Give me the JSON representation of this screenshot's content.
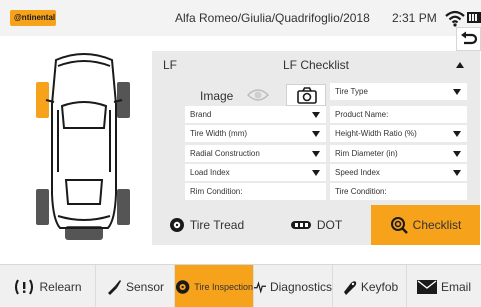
{
  "header": {
    "logo_text": "@ntinental",
    "vehicle_path": "Alfa Romeo/Giulia/Quadrifoglio/2018",
    "time": "2:31 PM",
    "wifi_icon": "wifi-icon",
    "battery_icon": "battery-icon",
    "back_icon": "back-arrow-icon"
  },
  "car": {
    "selected_tire": "LF",
    "highlight_color": "#f7a21b"
  },
  "panel": {
    "position_label": "LF",
    "title": "LF Checklist",
    "image_label": "Image",
    "fields": [
      {
        "label": "Tire Type",
        "dropdown": true
      },
      {
        "label": "Brand",
        "dropdown": true
      },
      {
        "label": "Product Name:",
        "dropdown": false
      },
      {
        "label": "Tire Width (mm)",
        "dropdown": true
      },
      {
        "label": "Height-Width Ratio (%)",
        "dropdown": true
      },
      {
        "label": "Radial Construction",
        "dropdown": true
      },
      {
        "label": "Rim Diameter (in)",
        "dropdown": true
      },
      {
        "label": "Load Index",
        "dropdown": true
      },
      {
        "label": "Speed Index",
        "dropdown": true
      },
      {
        "label": "Rim Condition:",
        "dropdown": false
      },
      {
        "label": "Tire Condition:",
        "dropdown": false
      }
    ]
  },
  "tabs": [
    {
      "label": "Tire Tread",
      "icon": "tire-icon",
      "active": false
    },
    {
      "label": "DOT",
      "icon": "dot-icon",
      "active": false
    },
    {
      "label": "Checklist",
      "icon": "checklist-icon",
      "active": true
    }
  ],
  "nav": [
    {
      "label": "Relearn",
      "icon": "tpms-warning-icon",
      "active": false
    },
    {
      "label": "Sensor",
      "icon": "sensor-icon",
      "active": false
    },
    {
      "label": "Tire Inspection",
      "icon": "tire-icon",
      "active": true
    },
    {
      "label": "Diagnostics",
      "icon": "pulse-icon",
      "active": false
    },
    {
      "label": "Keyfob",
      "icon": "keyfob-icon",
      "active": false
    },
    {
      "label": "Email",
      "icon": "email-icon",
      "active": false
    }
  ],
  "colors": {
    "accent": "#f7a21b",
    "panel_bg": "#eaeaea",
    "topbar_bg": "#f3f3f3"
  }
}
